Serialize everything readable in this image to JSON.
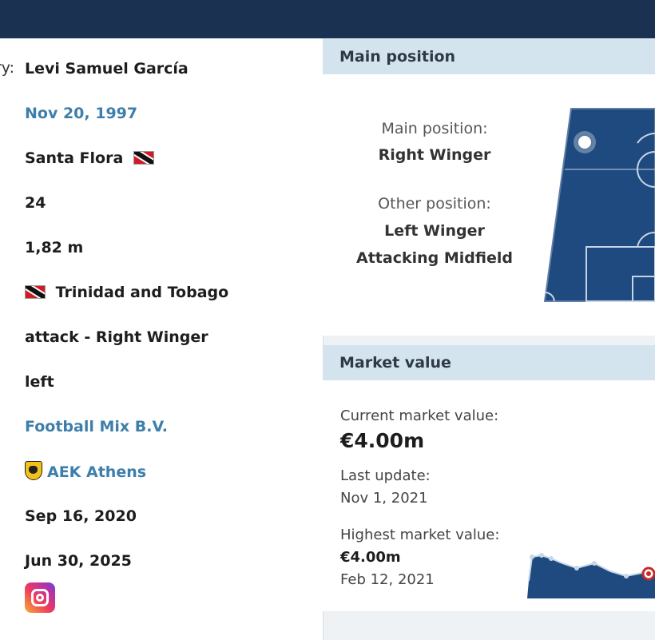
{
  "profile": {
    "cut_label": "ry:",
    "name": "Levi Samuel García",
    "birth_date": "Nov 20, 1997",
    "birth_place": "Santa Flora",
    "age": "24",
    "height": "1,82 m",
    "citizenship": "Trinidad and Tobago",
    "position": "attack - Right Winger",
    "foot": "left",
    "agent": "Football Mix B.V.",
    "club": "AEK Athens",
    "joined": "Sep 16, 2020",
    "contract_expires": "Jun 30, 2025"
  },
  "position_panel": {
    "title": "Main position",
    "main_label": "Main position:",
    "main_value": "Right Winger",
    "other_label": "Other position:",
    "other_values": [
      "Left Winger",
      "Attacking Midfield"
    ]
  },
  "market_panel": {
    "title": "Market value",
    "current_label": "Current market value:",
    "current_value": "€4.00m",
    "last_update_label": "Last update:",
    "last_update_value": "Nov 1, 2021",
    "highest_label": "Highest market value:",
    "highest_value": "€4.00m",
    "highest_date": "Feb 12, 2021"
  },
  "colors": {
    "header_bg": "#1a3151",
    "link": "#3d7faa",
    "panel_head": "#d4e4ee",
    "pitch": "#1f4a7f"
  }
}
